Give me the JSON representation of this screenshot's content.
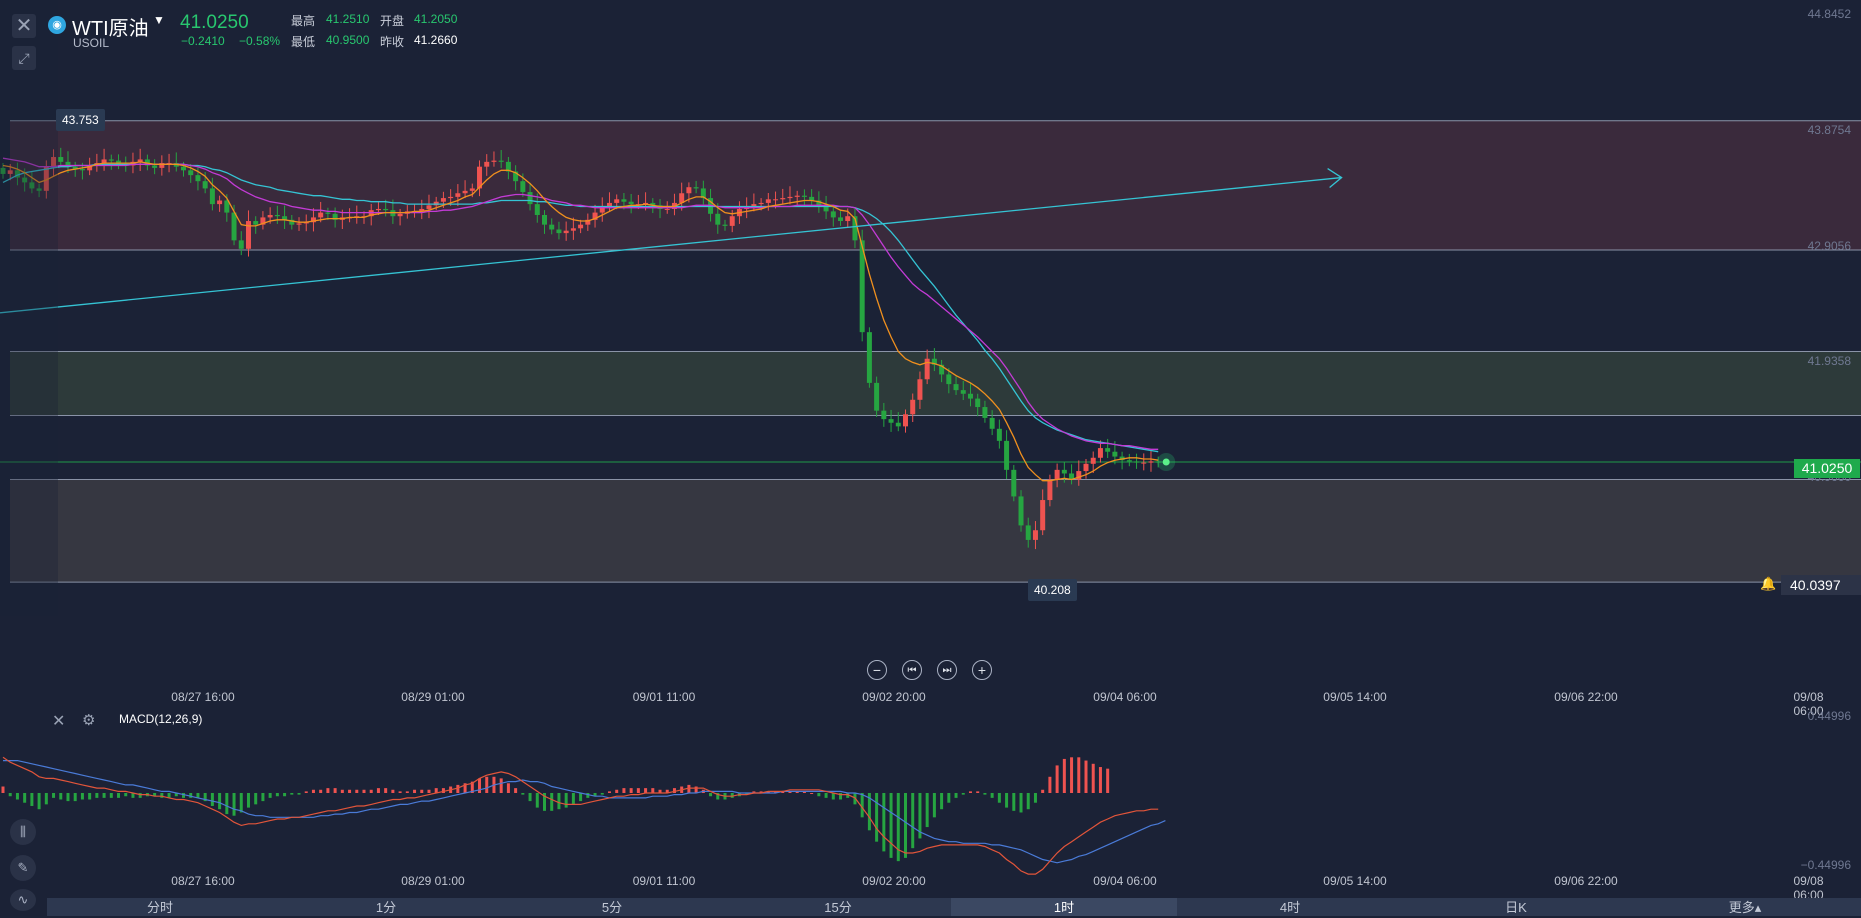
{
  "header": {
    "symbol_name": "WTI原油",
    "symbol_code": "USOIL",
    "last_price": "41.0250",
    "change": "−0.2410",
    "change_percent": "−0.58%",
    "stats": [
      {
        "label": "最高",
        "value": "41.2510",
        "color": "#28c76f"
      },
      {
        "label": "开盘",
        "value": "41.2050",
        "color": "#28c76f"
      },
      {
        "label": "最低",
        "value": "40.9500",
        "color": "#28c76f"
      },
      {
        "label": "昨收",
        "value": "41.2660",
        "color": "#ffffff"
      }
    ]
  },
  "price_axis": {
    "labels": [
      "44.8452",
      "43.8754",
      "42.9056",
      "41.9358",
      "40.9660"
    ],
    "current_price": "41.0250",
    "alert_price": "40.0397"
  },
  "annotations": {
    "high_tag": "43.753",
    "low_tag": "40.208"
  },
  "time_axis": {
    "labels": [
      "08/27 16:00",
      "08/29 01:00",
      "09/01 11:00",
      "09/02 20:00",
      "09/04 06:00",
      "09/05 14:00",
      "09/06 22:00",
      "09/08 06:00"
    ]
  },
  "macd": {
    "label": "MACD(12,26,9)",
    "axis_top": "0.44996",
    "axis_bottom": "−0.44996"
  },
  "timeframes": [
    {
      "label": "分时",
      "active": false
    },
    {
      "label": "1分",
      "active": false
    },
    {
      "label": "5分",
      "active": false
    },
    {
      "label": "15分",
      "active": false
    },
    {
      "label": "1时",
      "active": true
    },
    {
      "label": "4时",
      "active": false
    },
    {
      "label": "日K",
      "active": false
    },
    {
      "label": "更多▴",
      "active": false
    }
  ],
  "colors": {
    "up": "#ef5350",
    "down": "#26a541",
    "accent": "#28c76f",
    "trendline": "#35c4d4"
  },
  "chart_data": {
    "type": "candlestick",
    "ylim": [
      39.75,
      44.85
    ],
    "y_ticks": [
      44.8452,
      43.8754,
      42.9056,
      41.9358,
      40.966
    ],
    "zones": [
      {
        "from": 42.78,
        "to": 43.85,
        "color": "#3a2a3c"
      },
      {
        "from": 41.41,
        "to": 41.94,
        "color": "#2d3a3a"
      },
      {
        "from": 40.03,
        "to": 40.88,
        "color": "#363741"
      }
    ],
    "closes": [
      43.41,
      43.44,
      43.38,
      43.34,
      43.29,
      43.27,
      43.47,
      43.55,
      43.51,
      43.47,
      43.45,
      43.44,
      43.48,
      43.5,
      43.53,
      43.52,
      43.49,
      43.48,
      43.51,
      43.53,
      43.48,
      43.46,
      43.5,
      43.5,
      43.47,
      43.44,
      43.4,
      43.35,
      43.29,
      43.16,
      43.19,
      43.09,
      42.86,
      42.79,
      43.02,
      42.99,
      43.05,
      43.07,
      43.06,
      43.03,
      42.99,
      43,
      43.01,
      43.05,
      43.09,
      43.08,
      43.03,
      43.05,
      43.05,
      43.06,
      43.06,
      43.11,
      43.12,
      43.11,
      43.06,
      43.08,
      43.1,
      43.1,
      43.12,
      43.15,
      43.18,
      43.21,
      43.22,
      43.25,
      43.27,
      43.29,
      43.47,
      43.51,
      43.52,
      43.51,
      43.43,
      43.35,
      43.26,
      43.16,
      43.07,
      42.99,
      42.95,
      42.92,
      42.94,
      42.96,
      42.99,
      43.03,
      43.09,
      43.14,
      43.17,
      43.2,
      43.18,
      43.16,
      43.16,
      43.17,
      43.15,
      43.12,
      43.12,
      43.17,
      43.25,
      43.3,
      43.29,
      43.21,
      43.08,
      42.99,
      42.98,
      43.06,
      43.12,
      43.14,
      43.16,
      43.17,
      43.2,
      43.2,
      43.21,
      43.22,
      43.23,
      43.22,
      43.19,
      43.14,
      43.1,
      43.05,
      43.02,
      43.06,
      42.86,
      42.1,
      41.68,
      41.45,
      41.38,
      41.35,
      41.32,
      41.42,
      41.54,
      41.71,
      41.88,
      41.83,
      41.75,
      41.67,
      41.62,
      41.59,
      41.55,
      41.48,
      41.39,
      41.3,
      41.2,
      40.96,
      40.74,
      40.5,
      40.38,
      40.46,
      40.71,
      40.88,
      40.96,
      40.93,
      40.88,
      40.95,
      41.01,
      41.06,
      41.14,
      41.11,
      41.07,
      41.04,
      41.03,
      41.02,
      41.02,
      41.03,
      41.02
    ],
    "ma_fast": [
      43.48,
      43.47,
      43.45,
      43.42,
      43.38,
      43.34,
      43.36,
      43.39,
      43.42,
      43.44,
      43.45,
      43.46,
      43.47,
      43.49,
      43.5,
      43.5,
      43.5,
      43.5,
      43.5,
      43.51,
      43.5,
      43.49,
      43.49,
      43.49,
      43.49,
      43.48,
      43.46,
      43.43,
      43.39,
      43.32,
      43.27,
      43.21,
      43.1,
      42.99,
      42.98,
      42.98,
      43,
      43.02,
      43.03,
      43.03,
      43.02,
      43.01,
      43.01,
      43.02,
      43.03,
      43.04,
      43.04,
      43.04,
      43.05,
      43.05,
      43.05,
      43.07,
      43.08,
      43.09,
      43.09,
      43.09,
      43.09,
      43.1,
      43.1,
      43.11,
      43.13,
      43.15,
      43.17,
      43.19,
      43.22,
      43.24,
      43.3,
      43.36,
      43.41,
      43.44,
      43.44,
      43.42,
      43.38,
      43.33,
      43.27,
      43.2,
      43.14,
      43.09,
      43.05,
      43.03,
      43.02,
      43.02,
      43.04,
      43.07,
      43.1,
      43.13,
      43.14,
      43.15,
      43.15,
      43.16,
      43.15,
      43.14,
      43.14,
      43.14,
      43.17,
      43.2,
      43.22,
      43.22,
      43.18,
      43.13,
      43.09,
      43.08,
      43.09,
      43.1,
      43.11,
      43.12,
      43.14,
      43.15,
      43.16,
      43.17,
      43.18,
      43.19,
      43.19,
      43.18,
      43.16,
      43.14,
      43.11,
      43.1,
      43.04,
      42.81,
      42.58,
      42.38,
      42.2,
      42.06,
      41.94,
      41.88,
      41.85,
      41.83,
      41.85,
      41.84,
      41.82,
      41.78,
      41.74,
      41.71,
      41.68,
      41.64,
      41.59,
      41.53,
      41.46,
      41.35,
      41.23,
      41.09,
      40.98,
      40.92,
      40.87,
      40.87,
      40.88,
      40.89,
      40.88,
      40.9,
      40.92,
      40.95,
      40.99,
      41.02,
      41.04,
      41.05,
      41.06,
      41.06,
      41.05,
      41.05,
      41.04
    ],
    "ma_slow": [
      43.54,
      43.53,
      43.52,
      43.51,
      43.49,
      43.47,
      43.47,
      43.47,
      43.48,
      43.48,
      43.48,
      43.48,
      43.48,
      43.48,
      43.48,
      43.48,
      43.48,
      43.48,
      43.49,
      43.49,
      43.49,
      43.49,
      43.49,
      43.49,
      43.49,
      43.49,
      43.48,
      43.47,
      43.45,
      43.42,
      43.4,
      43.37,
      43.32,
      43.28,
      43.25,
      43.22,
      43.2,
      43.18,
      43.17,
      43.16,
      43.14,
      43.13,
      43.12,
      43.11,
      43.11,
      43.1,
      43.1,
      43.09,
      43.09,
      43.09,
      43.09,
      43.09,
      43.09,
      43.09,
      43.09,
      43.09,
      43.09,
      43.09,
      43.09,
      43.1,
      43.1,
      43.11,
      43.11,
      43.12,
      43.13,
      43.14,
      43.16,
      43.18,
      43.2,
      43.22,
      43.23,
      43.24,
      43.24,
      43.23,
      43.22,
      43.21,
      43.19,
      43.18,
      43.17,
      43.15,
      43.15,
      43.14,
      43.13,
      43.13,
      43.13,
      43.13,
      43.13,
      43.13,
      43.13,
      43.13,
      43.13,
      43.13,
      43.13,
      43.13,
      43.13,
      43.14,
      43.15,
      43.15,
      43.15,
      43.14,
      43.13,
      43.13,
      43.13,
      43.13,
      43.13,
      43.13,
      43.14,
      43.14,
      43.14,
      43.14,
      43.15,
      43.15,
      43.15,
      43.15,
      43.15,
      43.15,
      43.14,
      43.14,
      43.13,
      43.07,
      42.99,
      42.9,
      42.81,
      42.72,
      42.64,
      42.57,
      42.5,
      42.45,
      42.41,
      42.36,
      42.31,
      42.26,
      42.21,
      42.16,
      42.11,
      42.06,
      42,
      41.94,
      41.88,
      41.8,
      41.71,
      41.62,
      41.52,
      41.44,
      41.38,
      41.34,
      41.3,
      41.27,
      41.24,
      41.22,
      41.2,
      41.19,
      41.18,
      41.18,
      41.17,
      41.16,
      41.16,
      41.15,
      41.14,
      41.13,
      41.13
    ],
    "ma_long": [
      43.34,
      43.37,
      43.4,
      43.42,
      43.43,
      43.44,
      43.45,
      43.46,
      43.47,
      43.47,
      43.48,
      43.48,
      43.48,
      43.49,
      43.49,
      43.49,
      43.49,
      43.49,
      43.49,
      43.49,
      43.49,
      43.49,
      43.49,
      43.49,
      43.49,
      43.49,
      43.48,
      43.48,
      43.47,
      43.45,
      43.44,
      43.42,
      43.39,
      43.36,
      43.34,
      43.32,
      43.31,
      43.3,
      43.28,
      43.27,
      43.26,
      43.25,
      43.24,
      43.23,
      43.23,
      43.22,
      43.21,
      43.2,
      43.2,
      43.19,
      43.19,
      43.18,
      43.18,
      43.18,
      43.17,
      43.17,
      43.16,
      43.16,
      43.16,
      43.16,
      43.16,
      43.16,
      43.16,
      43.16,
      43.16,
      43.16,
      43.17,
      43.17,
      43.18,
      43.19,
      43.19,
      43.19,
      43.19,
      43.19,
      43.18,
      43.18,
      43.17,
      43.16,
      43.15,
      43.15,
      43.14,
      43.14,
      43.14,
      43.14,
      43.14,
      43.14,
      43.14,
      43.14,
      43.14,
      43.14,
      43.14,
      43.14,
      43.14,
      43.14,
      43.14,
      43.14,
      43.14,
      43.14,
      43.14,
      43.14,
      43.14,
      43.14,
      43.14,
      43.14,
      43.14,
      43.14,
      43.14,
      43.14,
      43.14,
      43.14,
      43.14,
      43.14,
      43.14,
      43.14,
      43.14,
      43.14,
      43.14,
      43.14,
      43.13,
      43.11,
      43.08,
      43.04,
      42.99,
      42.93,
      42.86,
      42.78,
      42.7,
      42.62,
      42.55,
      42.48,
      42.4,
      42.32,
      42.24,
      42.17,
      42.1,
      42.03,
      41.95,
      41.88,
      41.8,
      41.71,
      41.62,
      41.53,
      41.45,
      41.39,
      41.35,
      41.32,
      41.29,
      41.27,
      41.25,
      41.23,
      41.21,
      41.2,
      41.19,
      41.18,
      41.17,
      41.16,
      41.15,
      41.14,
      41.13,
      41.12,
      41.11
    ],
    "trend_line": {
      "from": [
        0,
        42.26
      ],
      "to": [
        1.56,
        43.38
      ]
    },
    "macd_hist": [
      0.04,
      -0.02,
      -0.04,
      -0.06,
      -0.08,
      -0.1,
      -0.07,
      -0.03,
      -0.04,
      -0.05,
      -0.05,
      -0.04,
      -0.04,
      -0.03,
      -0.03,
      -0.03,
      -0.03,
      -0.02,
      -0.03,
      -0.03,
      -0.02,
      -0.02,
      -0.03,
      -0.03,
      -0.02,
      -0.03,
      -0.03,
      -0.03,
      -0.05,
      -0.08,
      -0.1,
      -0.13,
      -0.14,
      -0.12,
      -0.09,
      -0.07,
      -0.05,
      -0.03,
      -0.02,
      -0.02,
      -0.01,
      -0.01,
      0.01,
      0.02,
      0.02,
      0.03,
      0.03,
      0.02,
      0.02,
      0.02,
      0.02,
      0.02,
      0.03,
      0.03,
      0.02,
      0.01,
      0.01,
      0.02,
      0.02,
      0.02,
      0.03,
      0.03,
      0.04,
      0.05,
      0.06,
      0.07,
      0.09,
      0.1,
      0.1,
      0.09,
      0.06,
      0.03,
      -0.01,
      -0.05,
      -0.09,
      -0.11,
      -0.11,
      -0.1,
      -0.09,
      -0.07,
      -0.05,
      -0.03,
      -0.02,
      -0.01,
      0.01,
      0.02,
      0.03,
      0.03,
      0.03,
      0.03,
      0.03,
      0.02,
      0.02,
      0.03,
      0.04,
      0.05,
      0.04,
      0.02,
      -0.02,
      -0.04,
      -0.04,
      -0.03,
      -0.02,
      -0.01,
      0.01,
      0.01,
      0.01,
      0.01,
      0.01,
      0.01,
      0.01,
      0.01,
      0,
      -0.02,
      -0.03,
      -0.04,
      -0.04,
      -0.03,
      -0.07,
      -0.15,
      -0.23,
      -0.3,
      -0.36,
      -0.4,
      -0.42,
      -0.4,
      -0.34,
      -0.28,
      -0.21,
      -0.15,
      -0.1,
      -0.06,
      -0.03,
      -0.01,
      0.01,
      0.01,
      -0.01,
      -0.03,
      -0.06,
      -0.09,
      -0.11,
      -0.12,
      -0.1,
      -0.06,
      0.02,
      0.1,
      0.17,
      0.21,
      0.22,
      0.22,
      0.2,
      0.18,
      0.16,
      0.15
    ],
    "macd_dif": [
      0.22,
      0.19,
      0.17,
      0.15,
      0.13,
      0.1,
      0.09,
      0.09,
      0.08,
      0.07,
      0.06,
      0.05,
      0.04,
      0.03,
      0.03,
      0.02,
      0.01,
      0.01,
      0,
      -0.01,
      -0.01,
      -0.02,
      -0.02,
      -0.03,
      -0.04,
      -0.04,
      -0.05,
      -0.06,
      -0.08,
      -0.1,
      -0.12,
      -0.15,
      -0.18,
      -0.2,
      -0.19,
      -0.19,
      -0.18,
      -0.17,
      -0.16,
      -0.16,
      -0.15,
      -0.15,
      -0.14,
      -0.13,
      -0.12,
      -0.11,
      -0.11,
      -0.1,
      -0.09,
      -0.08,
      -0.08,
      -0.07,
      -0.06,
      -0.05,
      -0.04,
      -0.04,
      -0.03,
      -0.03,
      -0.02,
      -0.01,
      0,
      0.01,
      0.02,
      0.03,
      0.05,
      0.06,
      0.09,
      0.11,
      0.12,
      0.13,
      0.12,
      0.1,
      0.07,
      0.04,
      0.01,
      -0.02,
      -0.04,
      -0.06,
      -0.07,
      -0.07,
      -0.07,
      -0.06,
      -0.05,
      -0.04,
      -0.03,
      -0.02,
      -0.02,
      -0.01,
      -0.01,
      0,
      0,
      0,
      0,
      0.01,
      0.02,
      0.03,
      0.03,
      0.03,
      0.01,
      -0.01,
      -0.02,
      -0.02,
      -0.01,
      -0.01,
      0,
      0,
      0.01,
      0.01,
      0.01,
      0.02,
      0.02,
      0.02,
      0.02,
      0.02,
      0.01,
      0,
      -0.01,
      -0.01,
      -0.03,
      -0.09,
      -0.15,
      -0.22,
      -0.27,
      -0.31,
      -0.35,
      -0.37,
      -0.37,
      -0.36,
      -0.34,
      -0.33,
      -0.32,
      -0.32,
      -0.32,
      -0.32,
      -0.32,
      -0.32,
      -0.33,
      -0.35,
      -0.37,
      -0.41,
      -0.44,
      -0.48,
      -0.5,
      -0.5,
      -0.47,
      -0.42,
      -0.37,
      -0.33,
      -0.3,
      -0.27,
      -0.24,
      -0.21,
      -0.18,
      -0.16,
      -0.14,
      -0.13,
      -0.12,
      -0.11,
      -0.11,
      -0.1,
      -0.1
    ],
    "macd_dea": [
      0.2,
      0.2,
      0.2,
      0.19,
      0.18,
      0.17,
      0.16,
      0.15,
      0.14,
      0.13,
      0.12,
      0.11,
      0.1,
      0.09,
      0.08,
      0.07,
      0.06,
      0.05,
      0.05,
      0.04,
      0.03,
      0.02,
      0.01,
      0.01,
      0,
      -0.01,
      -0.02,
      -0.03,
      -0.04,
      -0.05,
      -0.06,
      -0.08,
      -0.1,
      -0.11,
      -0.13,
      -0.14,
      -0.14,
      -0.15,
      -0.15,
      -0.15,
      -0.15,
      -0.15,
      -0.15,
      -0.15,
      -0.14,
      -0.14,
      -0.13,
      -0.13,
      -0.12,
      -0.12,
      -0.11,
      -0.1,
      -0.1,
      -0.09,
      -0.08,
      -0.07,
      -0.07,
      -0.06,
      -0.05,
      -0.05,
      -0.04,
      -0.03,
      -0.02,
      -0.01,
      0,
      0.01,
      0.02,
      0.03,
      0.05,
      0.06,
      0.07,
      0.07,
      0.08,
      0.07,
      0.07,
      0.06,
      0.04,
      0.03,
      0.02,
      0.01,
      0,
      -0.01,
      -0.02,
      -0.02,
      -0.03,
      -0.03,
      -0.03,
      -0.03,
      -0.03,
      -0.03,
      -0.02,
      -0.02,
      -0.02,
      -0.01,
      -0.01,
      0,
      0,
      0.01,
      0.01,
      0.01,
      0.01,
      0.01,
      0,
      0,
      0,
      0,
      0,
      0,
      0.01,
      0.01,
      0.01,
      0.01,
      0.01,
      0.01,
      0.01,
      0.01,
      0.01,
      0,
      0,
      -0.01,
      -0.03,
      -0.06,
      -0.09,
      -0.12,
      -0.15,
      -0.18,
      -0.21,
      -0.24,
      -0.26,
      -0.28,
      -0.29,
      -0.3,
      -0.3,
      -0.31,
      -0.31,
      -0.31,
      -0.31,
      -0.32,
      -0.32,
      -0.33,
      -0.34,
      -0.35,
      -0.37,
      -0.39,
      -0.41,
      -0.42,
      -0.43,
      -0.42,
      -0.41,
      -0.39,
      -0.38,
      -0.36,
      -0.34,
      -0.32,
      -0.3,
      -0.28,
      -0.26,
      -0.24,
      -0.22,
      -0.2,
      -0.19,
      -0.17
    ],
    "macd_ylim": [
      -0.44996,
      0.44996
    ]
  }
}
